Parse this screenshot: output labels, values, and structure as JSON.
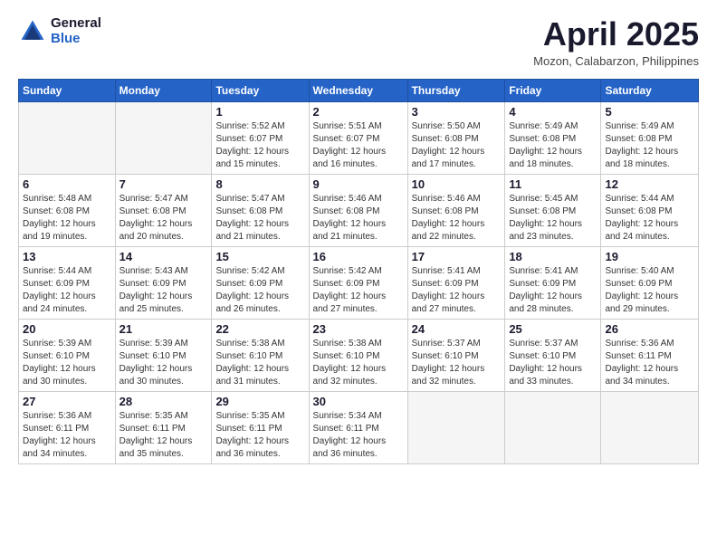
{
  "header": {
    "logo_general": "General",
    "logo_blue": "Blue",
    "title": "April 2025",
    "location": "Mozon, Calabarzon, Philippines"
  },
  "weekdays": [
    "Sunday",
    "Monday",
    "Tuesday",
    "Wednesday",
    "Thursday",
    "Friday",
    "Saturday"
  ],
  "weeks": [
    [
      {
        "day": "",
        "sunrise": "",
        "sunset": "",
        "daylight": ""
      },
      {
        "day": "",
        "sunrise": "",
        "sunset": "",
        "daylight": ""
      },
      {
        "day": "1",
        "sunrise": "Sunrise: 5:52 AM",
        "sunset": "Sunset: 6:07 PM",
        "daylight": "Daylight: 12 hours and 15 minutes."
      },
      {
        "day": "2",
        "sunrise": "Sunrise: 5:51 AM",
        "sunset": "Sunset: 6:07 PM",
        "daylight": "Daylight: 12 hours and 16 minutes."
      },
      {
        "day": "3",
        "sunrise": "Sunrise: 5:50 AM",
        "sunset": "Sunset: 6:08 PM",
        "daylight": "Daylight: 12 hours and 17 minutes."
      },
      {
        "day": "4",
        "sunrise": "Sunrise: 5:49 AM",
        "sunset": "Sunset: 6:08 PM",
        "daylight": "Daylight: 12 hours and 18 minutes."
      },
      {
        "day": "5",
        "sunrise": "Sunrise: 5:49 AM",
        "sunset": "Sunset: 6:08 PM",
        "daylight": "Daylight: 12 hours and 18 minutes."
      }
    ],
    [
      {
        "day": "6",
        "sunrise": "Sunrise: 5:48 AM",
        "sunset": "Sunset: 6:08 PM",
        "daylight": "Daylight: 12 hours and 19 minutes."
      },
      {
        "day": "7",
        "sunrise": "Sunrise: 5:47 AM",
        "sunset": "Sunset: 6:08 PM",
        "daylight": "Daylight: 12 hours and 20 minutes."
      },
      {
        "day": "8",
        "sunrise": "Sunrise: 5:47 AM",
        "sunset": "Sunset: 6:08 PM",
        "daylight": "Daylight: 12 hours and 21 minutes."
      },
      {
        "day": "9",
        "sunrise": "Sunrise: 5:46 AM",
        "sunset": "Sunset: 6:08 PM",
        "daylight": "Daylight: 12 hours and 21 minutes."
      },
      {
        "day": "10",
        "sunrise": "Sunrise: 5:46 AM",
        "sunset": "Sunset: 6:08 PM",
        "daylight": "Daylight: 12 hours and 22 minutes."
      },
      {
        "day": "11",
        "sunrise": "Sunrise: 5:45 AM",
        "sunset": "Sunset: 6:08 PM",
        "daylight": "Daylight: 12 hours and 23 minutes."
      },
      {
        "day": "12",
        "sunrise": "Sunrise: 5:44 AM",
        "sunset": "Sunset: 6:08 PM",
        "daylight": "Daylight: 12 hours and 24 minutes."
      }
    ],
    [
      {
        "day": "13",
        "sunrise": "Sunrise: 5:44 AM",
        "sunset": "Sunset: 6:09 PM",
        "daylight": "Daylight: 12 hours and 24 minutes."
      },
      {
        "day": "14",
        "sunrise": "Sunrise: 5:43 AM",
        "sunset": "Sunset: 6:09 PM",
        "daylight": "Daylight: 12 hours and 25 minutes."
      },
      {
        "day": "15",
        "sunrise": "Sunrise: 5:42 AM",
        "sunset": "Sunset: 6:09 PM",
        "daylight": "Daylight: 12 hours and 26 minutes."
      },
      {
        "day": "16",
        "sunrise": "Sunrise: 5:42 AM",
        "sunset": "Sunset: 6:09 PM",
        "daylight": "Daylight: 12 hours and 27 minutes."
      },
      {
        "day": "17",
        "sunrise": "Sunrise: 5:41 AM",
        "sunset": "Sunset: 6:09 PM",
        "daylight": "Daylight: 12 hours and 27 minutes."
      },
      {
        "day": "18",
        "sunrise": "Sunrise: 5:41 AM",
        "sunset": "Sunset: 6:09 PM",
        "daylight": "Daylight: 12 hours and 28 minutes."
      },
      {
        "day": "19",
        "sunrise": "Sunrise: 5:40 AM",
        "sunset": "Sunset: 6:09 PM",
        "daylight": "Daylight: 12 hours and 29 minutes."
      }
    ],
    [
      {
        "day": "20",
        "sunrise": "Sunrise: 5:39 AM",
        "sunset": "Sunset: 6:10 PM",
        "daylight": "Daylight: 12 hours and 30 minutes."
      },
      {
        "day": "21",
        "sunrise": "Sunrise: 5:39 AM",
        "sunset": "Sunset: 6:10 PM",
        "daylight": "Daylight: 12 hours and 30 minutes."
      },
      {
        "day": "22",
        "sunrise": "Sunrise: 5:38 AM",
        "sunset": "Sunset: 6:10 PM",
        "daylight": "Daylight: 12 hours and 31 minutes."
      },
      {
        "day": "23",
        "sunrise": "Sunrise: 5:38 AM",
        "sunset": "Sunset: 6:10 PM",
        "daylight": "Daylight: 12 hours and 32 minutes."
      },
      {
        "day": "24",
        "sunrise": "Sunrise: 5:37 AM",
        "sunset": "Sunset: 6:10 PM",
        "daylight": "Daylight: 12 hours and 32 minutes."
      },
      {
        "day": "25",
        "sunrise": "Sunrise: 5:37 AM",
        "sunset": "Sunset: 6:10 PM",
        "daylight": "Daylight: 12 hours and 33 minutes."
      },
      {
        "day": "26",
        "sunrise": "Sunrise: 5:36 AM",
        "sunset": "Sunset: 6:11 PM",
        "daylight": "Daylight: 12 hours and 34 minutes."
      }
    ],
    [
      {
        "day": "27",
        "sunrise": "Sunrise: 5:36 AM",
        "sunset": "Sunset: 6:11 PM",
        "daylight": "Daylight: 12 hours and 34 minutes."
      },
      {
        "day": "28",
        "sunrise": "Sunrise: 5:35 AM",
        "sunset": "Sunset: 6:11 PM",
        "daylight": "Daylight: 12 hours and 35 minutes."
      },
      {
        "day": "29",
        "sunrise": "Sunrise: 5:35 AM",
        "sunset": "Sunset: 6:11 PM",
        "daylight": "Daylight: 12 hours and 36 minutes."
      },
      {
        "day": "30",
        "sunrise": "Sunrise: 5:34 AM",
        "sunset": "Sunset: 6:11 PM",
        "daylight": "Daylight: 12 hours and 36 minutes."
      },
      {
        "day": "",
        "sunrise": "",
        "sunset": "",
        "daylight": ""
      },
      {
        "day": "",
        "sunrise": "",
        "sunset": "",
        "daylight": ""
      },
      {
        "day": "",
        "sunrise": "",
        "sunset": "",
        "daylight": ""
      }
    ]
  ]
}
